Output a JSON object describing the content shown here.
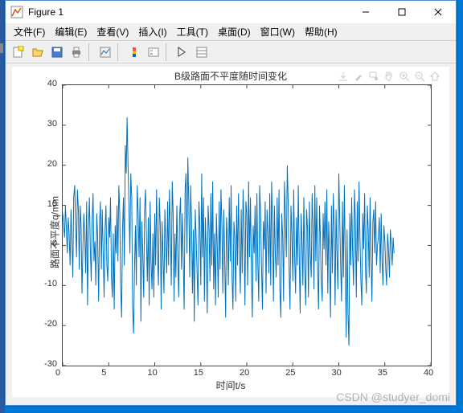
{
  "window": {
    "title": "Figure 1",
    "min": "—",
    "max": "☐",
    "close": "✕"
  },
  "menu": {
    "file": "文件(F)",
    "edit": "编辑(E)",
    "view": "查看(V)",
    "insert": "插入(I)",
    "tools": "工具(T)",
    "desktop": "桌面(D)",
    "window": "窗口(W)",
    "help": "帮助(H)"
  },
  "chart_data": {
    "type": "line",
    "title": "B级路面不平度随时间变化",
    "xlabel": "时间t/s",
    "ylabel": "路面不平度q/mm",
    "xlim": [
      0,
      40
    ],
    "ylim": [
      -30,
      40
    ],
    "xticks": [
      0,
      5,
      10,
      15,
      20,
      25,
      30,
      35,
      40
    ],
    "yticks": [
      -30,
      -20,
      -10,
      0,
      10,
      20,
      30,
      40
    ],
    "x": [
      0,
      0.1,
      0.2,
      0.3,
      0.4,
      0.5,
      0.6,
      0.7,
      0.8,
      0.9,
      1,
      1.1,
      1.2,
      1.3,
      1.4,
      1.5,
      1.6,
      1.7,
      1.8,
      1.9,
      2,
      2.1,
      2.2,
      2.3,
      2.4,
      2.5,
      2.6,
      2.7,
      2.8,
      2.9,
      3,
      3.1,
      3.2,
      3.3,
      3.4,
      3.5,
      3.6,
      3.7,
      3.8,
      3.9,
      4,
      4.1,
      4.2,
      4.3,
      4.4,
      4.5,
      4.6,
      4.7,
      4.8,
      4.9,
      5,
      5.1,
      5.2,
      5.3,
      5.4,
      5.5,
      5.6,
      5.7,
      5.8,
      5.9,
      6,
      6.1,
      6.2,
      6.3,
      6.4,
      6.5,
      6.6,
      6.7,
      6.8,
      6.9,
      7,
      7.1,
      7.2,
      7.3,
      7.4,
      7.5,
      7.6,
      7.7,
      7.8,
      7.9,
      8,
      8.1,
      8.2,
      8.3,
      8.4,
      8.5,
      8.6,
      8.7,
      8.8,
      8.9,
      9,
      9.1,
      9.2,
      9.3,
      9.4,
      9.5,
      9.6,
      9.7,
      9.8,
      9.9,
      10,
      10.1,
      10.2,
      10.3,
      10.4,
      10.5,
      10.6,
      10.7,
      10.8,
      10.9,
      11,
      11.1,
      11.2,
      11.3,
      11.4,
      11.5,
      11.6,
      11.7,
      11.8,
      11.9,
      12,
      12.1,
      12.2,
      12.3,
      12.4,
      12.5,
      12.6,
      12.7,
      12.8,
      12.9,
      13,
      13.1,
      13.2,
      13.3,
      13.4,
      13.5,
      13.6,
      13.7,
      13.8,
      13.9,
      14,
      14.1,
      14.2,
      14.3,
      14.4,
      14.5,
      14.6,
      14.7,
      14.8,
      14.9,
      15,
      15.1,
      15.2,
      15.3,
      15.4,
      15.5,
      15.6,
      15.7,
      15.8,
      15.9,
      16,
      16.1,
      16.2,
      16.3,
      16.4,
      16.5,
      16.6,
      16.7,
      16.8,
      16.9,
      17,
      17.1,
      17.2,
      17.3,
      17.4,
      17.5,
      17.6,
      17.7,
      17.8,
      17.9,
      18,
      18.1,
      18.2,
      18.3,
      18.4,
      18.5,
      18.6,
      18.7,
      18.8,
      18.9,
      19,
      19.1,
      19.2,
      19.3,
      19.4,
      19.5,
      19.6,
      19.7,
      19.8,
      19.9,
      20,
      20.1,
      20.2,
      20.3,
      20.4,
      20.5,
      20.6,
      20.7,
      20.8,
      20.9,
      21,
      21.1,
      21.2,
      21.3,
      21.4,
      21.5,
      21.6,
      21.7,
      21.8,
      21.9,
      22,
      22.1,
      22.2,
      22.3,
      22.4,
      22.5,
      22.6,
      22.7,
      22.8,
      22.9,
      23,
      23.1,
      23.2,
      23.3,
      23.4,
      23.5,
      23.6,
      23.7,
      23.8,
      23.9,
      24,
      24.1,
      24.2,
      24.3,
      24.4,
      24.5,
      24.6,
      24.7,
      24.8,
      24.9,
      25,
      25.1,
      25.2,
      25.3,
      25.4,
      25.5,
      25.6,
      25.7,
      25.8,
      25.9,
      26,
      26.1,
      26.2,
      26.3,
      26.4,
      26.5,
      26.6,
      26.7,
      26.8,
      26.9,
      27,
      27.1,
      27.2,
      27.3,
      27.4,
      27.5,
      27.6,
      27.7,
      27.8,
      27.9,
      28,
      28.1,
      28.2,
      28.3,
      28.4,
      28.5,
      28.6,
      28.7,
      28.8,
      28.9,
      29,
      29.1,
      29.2,
      29.3,
      29.4,
      29.5,
      29.6,
      29.7,
      29.8,
      29.9,
      30,
      30.1,
      30.2,
      30.3,
      30.4,
      30.5,
      30.6,
      30.7,
      30.8,
      30.9,
      31,
      31.1,
      31.2,
      31.3,
      31.4,
      31.5,
      31.6,
      31.7,
      31.8,
      31.9,
      32,
      32.1,
      32.2,
      32.3,
      32.4,
      32.5,
      32.6,
      32.7,
      32.8,
      32.9,
      33,
      33.1,
      33.2,
      33.3,
      33.4,
      33.5,
      33.6,
      33.7,
      33.8,
      33.9,
      34,
      34.1,
      34.2,
      34.3,
      34.4,
      34.5,
      34.6,
      34.7,
      34.8,
      34.9,
      35,
      35.1,
      35.2,
      35.3,
      35.4,
      35.5,
      35.6,
      35.7,
      35.8,
      35.9,
      36
    ],
    "y": [
      8,
      5,
      2,
      10,
      4,
      -2,
      7,
      3,
      -5,
      9,
      1,
      -8,
      12,
      15,
      6,
      -3,
      14,
      9,
      -6,
      10,
      5,
      -12,
      0,
      8,
      2,
      -7,
      11,
      -15,
      4,
      12,
      -1,
      -9,
      6,
      13,
      -4,
      1,
      -10,
      8,
      2,
      -14,
      5,
      11,
      -6,
      9,
      -2,
      -13,
      4,
      10,
      -5,
      -9,
      7,
      2,
      12,
      -8,
      -13,
      3,
      -16,
      5,
      -2,
      10,
      -4,
      15,
      8,
      -10,
      -18,
      4,
      12,
      -5,
      25,
      18,
      32,
      20,
      10,
      -2,
      18,
      12,
      -16,
      -22,
      -6,
      5,
      -10,
      15,
      8,
      -3,
      12,
      -19,
      6,
      -2,
      -13,
      9,
      14,
      2,
      -9,
      7,
      -15,
      11,
      -4,
      -11,
      3,
      -13,
      8,
      -5,
      14,
      -2,
      -10,
      12,
      5,
      -16,
      6,
      -3,
      -12,
      9,
      1,
      -7,
      11,
      -5,
      14,
      4,
      -10,
      16,
      8,
      -14,
      3,
      -8,
      10,
      -2,
      -13,
      7,
      12,
      -6,
      8,
      -4,
      -16,
      14,
      18,
      -2,
      22,
      10,
      -8,
      15,
      6,
      -12,
      4,
      -19,
      9,
      2,
      -7,
      -15,
      11,
      5,
      -10,
      18,
      -3,
      12,
      -14,
      7,
      -2,
      -17,
      10,
      4,
      -9,
      13,
      -5,
      16,
      -11,
      3,
      -15,
      8,
      -1,
      -13,
      11,
      -6,
      14,
      5,
      -12,
      9,
      -3,
      -18,
      7,
      1,
      -10,
      12,
      -4,
      15,
      -8,
      -16,
      6,
      2,
      -14,
      10,
      -5,
      13,
      -2,
      -12,
      9,
      -7,
      14,
      4,
      -15,
      11,
      8,
      -10,
      16,
      -3,
      12,
      -6,
      -18,
      5,
      -2,
      10,
      -9,
      13,
      -4,
      -14,
      15,
      8,
      -5,
      -16,
      6,
      -1,
      11,
      -12,
      9,
      3,
      -7,
      13,
      -10,
      16,
      5,
      -14,
      10,
      -2,
      -8,
      12,
      -5,
      14,
      -11,
      -18,
      8,
      2,
      -14,
      16,
      7,
      -3,
      20,
      11,
      -6,
      -16,
      10,
      3,
      -9,
      14,
      -2,
      -12,
      7,
      -5,
      15,
      -3,
      -17,
      8,
      1,
      -10,
      12,
      -6,
      -15,
      9,
      4,
      -13,
      11,
      -2,
      -8,
      13,
      5,
      -11,
      15,
      -4,
      12,
      -7,
      -16,
      10,
      2,
      -9,
      -14,
      8,
      -1,
      11,
      -5,
      14,
      -12,
      6,
      -3,
      -18,
      10,
      -7,
      13,
      4,
      -15,
      9,
      -2,
      -11,
      18,
      7,
      -5,
      -14,
      11,
      -8,
      15,
      -3,
      -23,
      4,
      -17,
      -25,
      8,
      -5,
      12,
      -2,
      -10,
      14,
      6,
      -13,
      11,
      -4,
      16,
      2,
      -9,
      -15,
      8,
      -1,
      13,
      -6,
      -12,
      10,
      4,
      -8,
      12,
      -3,
      -14,
      6,
      9,
      -2,
      11,
      -5,
      0,
      2,
      7,
      -7,
      8,
      -4,
      -10,
      5,
      1,
      -6,
      -10,
      3,
      -1,
      -8,
      4,
      0,
      -5,
      2,
      -2,
      -7,
      1,
      -3
    ],
    "color": "#0072bd"
  },
  "watermark": "CSDN @studyer_domi"
}
